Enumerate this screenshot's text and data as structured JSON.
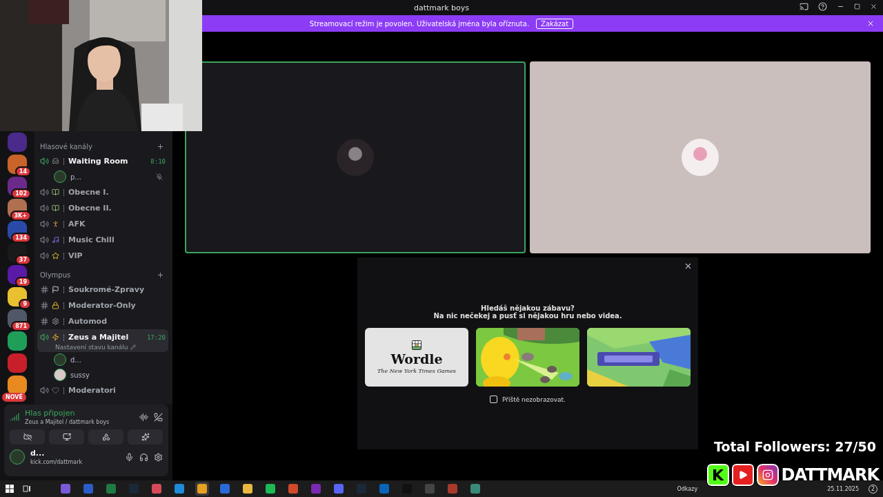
{
  "titlebar": {
    "title": "dattmark boys"
  },
  "banner": {
    "text": "Streamovací režim je povolen. Uživatelská jména byla oříznuta.",
    "button": "Zakázat"
  },
  "servers": [
    {
      "color": "#4a2a8a"
    },
    {
      "color": "#c8642a",
      "badge": "14"
    },
    {
      "color": "#6a2a8a",
      "badge": "102"
    },
    {
      "color": "#b07050",
      "badge": "3K+"
    },
    {
      "color": "#2a4aa8",
      "badge": "134"
    },
    {
      "color": "#1a1a1a",
      "badge": "37"
    },
    {
      "color": "#5a1aa8",
      "badge": "19"
    },
    {
      "color": "#e8c030",
      "badge": "9"
    },
    {
      "color": "#505868",
      "badge": "871"
    },
    {
      "color": "#1f9e5a"
    },
    {
      "color": "#c8202a"
    },
    {
      "color": "#e88a20",
      "label": "NOVÉ"
    }
  ],
  "categories": [
    {
      "name": "Hlasové kanály",
      "channels": [
        {
          "kind": "voice",
          "name": "Waiting Room",
          "time": "8:10",
          "selected": false,
          "active": true,
          "members": [
            {
              "name": "p...",
              "muted": true
            }
          ]
        },
        {
          "kind": "voice",
          "name": "Obecne I.",
          "selected": false,
          "active": false
        },
        {
          "kind": "voice",
          "name": "Obecne II.",
          "selected": false,
          "active": false
        },
        {
          "kind": "voice",
          "name": "AFK",
          "selected": false,
          "active": false
        },
        {
          "kind": "voice",
          "name": "Music Chill",
          "selected": false,
          "active": false
        },
        {
          "kind": "voice",
          "name": "VIP",
          "selected": false,
          "active": false
        }
      ]
    },
    {
      "name": "Olympus",
      "channels": [
        {
          "kind": "text",
          "name": "Soukromé-Zpravy",
          "selected": false
        },
        {
          "kind": "text",
          "name": "Moderator-Only",
          "selected": false
        },
        {
          "kind": "text",
          "name": "Automod",
          "selected": false
        },
        {
          "kind": "voice",
          "name": "Zeus a Majitel",
          "time": "17:20",
          "status": "Nastavení stavu kanálu",
          "selected": true,
          "active": true,
          "members": [
            {
              "name": "d...",
              "muted": false
            },
            {
              "name": "sussy",
              "muted": false
            }
          ]
        },
        {
          "kind": "voice",
          "name": "Moderatori",
          "selected": false,
          "active": false
        }
      ]
    }
  ],
  "voice": {
    "status": "Hlas připojen",
    "channel": "Zeus a Majitel / dattmark boys"
  },
  "user": {
    "name": "d...",
    "status": "kick.com/dattmark"
  },
  "tiles": [
    {
      "speaking": true
    },
    {
      "speaking": false
    }
  ],
  "activity": {
    "title": "Hledáš nějakou zábavu?",
    "subtitle": "Na nic nečekej a pusť si nějakou hru nebo videa.",
    "games": [
      {
        "kind": "wordle",
        "title": "Wordle",
        "publisher": "The New York Times Games"
      },
      {
        "kind": "farm"
      },
      {
        "kind": "putt"
      }
    ],
    "checkbox": {
      "label": "Příště nezobrazovat.",
      "checked": false
    }
  },
  "overlay": {
    "followers": "Total Followers: 27/50",
    "letter": "K",
    "brand": "DATTMARK"
  },
  "taskbar": {
    "apps": [
      {
        "color": "#7a5ad8",
        "selected": false
      },
      {
        "color": "#2b5cc8",
        "selected": false
      },
      {
        "color": "#1f7a44",
        "selected": false
      },
      {
        "color": "#1b2838",
        "selected": false
      },
      {
        "color": "#d84a5a",
        "selected": false
      },
      {
        "color": "#1f8ad8",
        "selected": false
      },
      {
        "color": "#e8a020",
        "selected": true
      },
      {
        "color": "#2a6ad8",
        "selected": false
      },
      {
        "color": "#e8b840",
        "selected": false
      },
      {
        "color": "#1db954",
        "selected": false
      },
      {
        "color": "#d04a2a",
        "selected": false
      },
      {
        "color": "#7a2ab0",
        "selected": false
      },
      {
        "color": "#5865f2",
        "selected": false
      },
      {
        "color": "#1b2838",
        "selected": false
      },
      {
        "color": "#0a64b8",
        "selected": false
      },
      {
        "color": "#111111",
        "selected": false
      },
      {
        "color": "#444444",
        "selected": false
      },
      {
        "color": "#a83a2a",
        "selected": false
      },
      {
        "color": "#3a8a7a",
        "selected": false
      }
    ],
    "links": "Odkazy",
    "date": "25.11.2025",
    "notifications": "2"
  }
}
